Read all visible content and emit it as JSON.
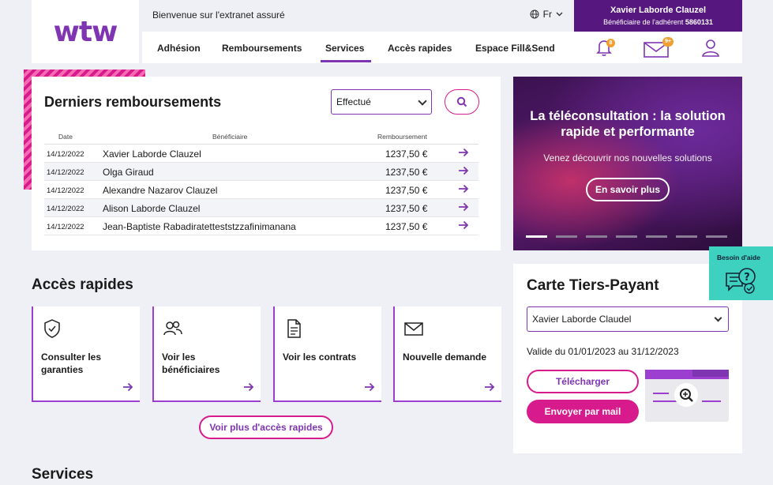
{
  "brand": {
    "logo_text": "wtw",
    "accent": "#7f35b2",
    "pink": "#d81b8c",
    "teal": "#3ed1bf"
  },
  "topbar": {
    "welcome": "Bienvenue sur l'extranet assuré",
    "language": "Fr"
  },
  "user": {
    "name": "Xavier Laborde Clauzel",
    "subtitle": "Bénéficiaire de l'adhérent",
    "member_number": "5860131"
  },
  "nav": {
    "items": [
      "Adhésion",
      "Remboursements",
      "Services",
      "Accès rapides",
      "Espace Fill&Send"
    ],
    "active": "Services",
    "notifications_badge": "8",
    "messages_badge": "9+"
  },
  "remboursements": {
    "title": "Derniers remboursements",
    "filter_value": "Effectué",
    "columns": [
      "Date",
      "Bénéficiaire",
      "Remboursement"
    ],
    "rows": [
      {
        "date": "14/12/2022",
        "beneficiary": "Xavier Laborde Clauzel",
        "amount": "1237,50 €"
      },
      {
        "date": "14/12/2022",
        "beneficiary": "Olga Giraud",
        "amount": "1237,50 €"
      },
      {
        "date": "14/12/2022",
        "beneficiary": "Alexandre Nazarov Clauzel",
        "amount": "1237,50 €"
      },
      {
        "date": "14/12/2022",
        "beneficiary": "Alison Laborde Clauzel",
        "amount": "1237,50 €"
      },
      {
        "date": "14/12/2022",
        "beneficiary": "Jean-Baptiste Rabadiratetteststzzafinimanana",
        "amount": "1237,50 €"
      }
    ]
  },
  "promo": {
    "title": "La téléconsultation : la solution rapide et performante",
    "subtitle": "Venez découvrir nos nouvelles solutions",
    "button": "En savoir plus",
    "slides": 7,
    "active_slide": 1
  },
  "acces": {
    "title": "Accès rapides",
    "tiles": [
      {
        "label": "Consulter les garanties",
        "icon": "shield-check-icon"
      },
      {
        "label": "Voir les bénéficiaires",
        "icon": "users-icon"
      },
      {
        "label": "Voir les contrats",
        "icon": "document-icon"
      },
      {
        "label": "Nouvelle demande",
        "icon": "envelope-icon"
      }
    ],
    "more_button": "Voir plus d'accès rapides"
  },
  "carte": {
    "title": "Carte Tiers-Payant",
    "selected": "Xavier Laborde Claudel",
    "validity": "Valide du 01/01/2023 au 31/12/2023",
    "download": "Télécharger",
    "send_mail": "Envoyer par mail"
  },
  "services": {
    "title": "Services"
  },
  "help": {
    "label": "Besoin d'aide"
  }
}
